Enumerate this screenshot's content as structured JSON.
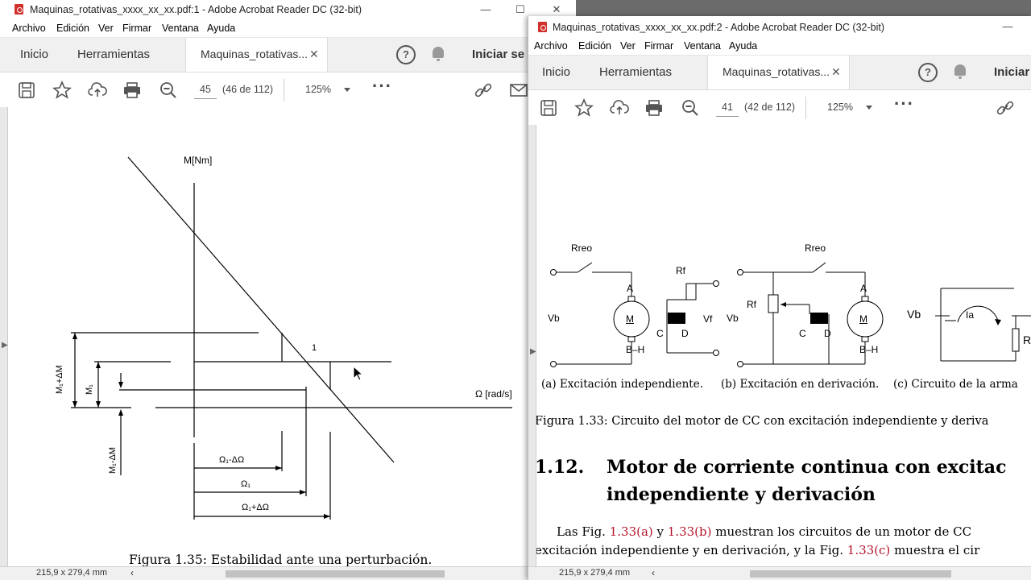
{
  "window1": {
    "title": "Maquinas_rotativas_xxxx_xx_xx.pdf:1 - Adobe Acrobat Reader DC (32-bit)",
    "menu": [
      "Archivo",
      "Edición",
      "Ver",
      "Firmar",
      "Ventana",
      "Ayuda"
    ],
    "tabs": {
      "home": "Inicio",
      "tools": "Herramientas",
      "doc": "Maquinas_rotativas..."
    },
    "signin": "Iniciar se",
    "page_current": "45",
    "page_of": "(46 de 112)",
    "zoom": "125%",
    "page_size": "215,9 x 279,4 mm",
    "figure": {
      "ylabel": "M[Nm]",
      "xlabel": "Ω [rad/s]",
      "point_label": "1",
      "m_plus": "M₁+ΔM",
      "m1": "M₁",
      "m_minus": "M₁-ΔM",
      "w_minus": "Ω₁-ΔΩ",
      "w1": "Ω₁",
      "w_plus": "Ω₁+ΔΩ",
      "caption": "Figura 1.35: Estabilidad ante una perturbación."
    }
  },
  "window2": {
    "title": "Maquinas_rotativas_xxxx_xx_xx.pdf:2 - Adobe Acrobat Reader DC (32-bit)",
    "menu": [
      "Archivo",
      "Edición",
      "Ver",
      "Firmar",
      "Ventana",
      "Ayuda"
    ],
    "tabs": {
      "home": "Inicio",
      "tools": "Herramientas",
      "doc": "Maquinas_rotativas..."
    },
    "signin": "Iniciar",
    "page_current": "41",
    "page_of": "(42 de 112)",
    "zoom": "125%",
    "page_size": "215,9 x 279,4 mm",
    "circuit": {
      "rreo": "Rreo",
      "rf": "Rf",
      "vb": "Vb",
      "vf": "Vf",
      "a": "A",
      "bh": "B–H",
      "c": "C",
      "d": "D",
      "m": "M",
      "ia": "Ia",
      "r": "R"
    },
    "subcaptions": [
      "(a) Excitación independiente.",
      "(b) Excitación en derivación.",
      "(c) Circuito de la arma"
    ],
    "figure_caption": "Figura 1.33: Circuito del motor de CC con excitación independiente y deriva",
    "section_number": "1.12.",
    "section_title_line1": "Motor de corriente continua con excitac",
    "section_title_line2": "independiente y derivación",
    "para_line1": {
      "pre": "Las Fig. ",
      "ref_a": "1.33(a)",
      "mid": " y ",
      "ref_b": "1.33(b)",
      "post": " muestran los circuitos de un motor de CC"
    },
    "para_line2": {
      "pre": "excitación independiente y en derivación, y la Fig. ",
      "ref_c": "1.33(c)",
      "post": " muestra el cir"
    }
  }
}
